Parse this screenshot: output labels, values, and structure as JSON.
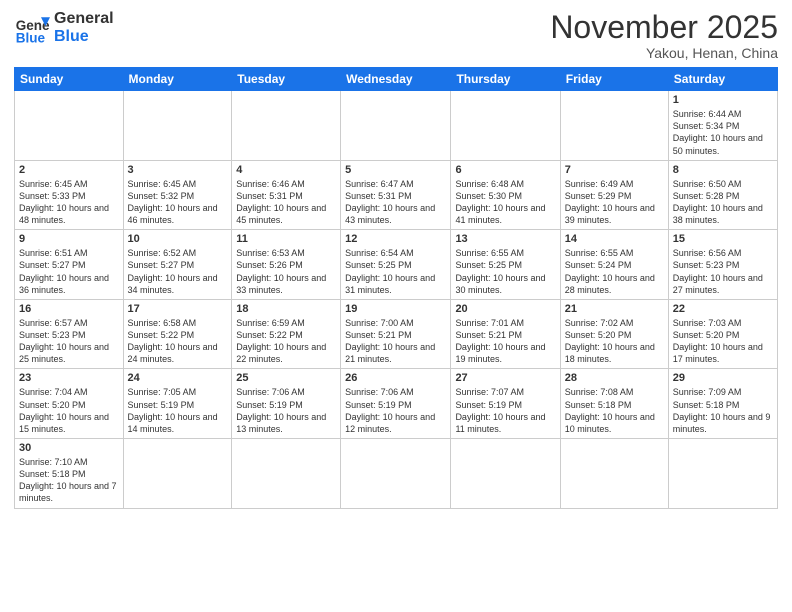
{
  "logo": {
    "text_general": "General",
    "text_blue": "Blue"
  },
  "header": {
    "month": "November 2025",
    "location": "Yakou, Henan, China"
  },
  "days_of_week": [
    "Sunday",
    "Monday",
    "Tuesday",
    "Wednesday",
    "Thursday",
    "Friday",
    "Saturday"
  ],
  "weeks": [
    [
      {
        "day": "",
        "info": ""
      },
      {
        "day": "",
        "info": ""
      },
      {
        "day": "",
        "info": ""
      },
      {
        "day": "",
        "info": ""
      },
      {
        "day": "",
        "info": ""
      },
      {
        "day": "",
        "info": ""
      },
      {
        "day": "1",
        "info": "Sunrise: 6:44 AM\nSunset: 5:34 PM\nDaylight: 10 hours and 50 minutes."
      }
    ],
    [
      {
        "day": "2",
        "info": "Sunrise: 6:45 AM\nSunset: 5:33 PM\nDaylight: 10 hours and 48 minutes."
      },
      {
        "day": "3",
        "info": "Sunrise: 6:45 AM\nSunset: 5:32 PM\nDaylight: 10 hours and 46 minutes."
      },
      {
        "day": "4",
        "info": "Sunrise: 6:46 AM\nSunset: 5:31 PM\nDaylight: 10 hours and 45 minutes."
      },
      {
        "day": "5",
        "info": "Sunrise: 6:47 AM\nSunset: 5:31 PM\nDaylight: 10 hours and 43 minutes."
      },
      {
        "day": "6",
        "info": "Sunrise: 6:48 AM\nSunset: 5:30 PM\nDaylight: 10 hours and 41 minutes."
      },
      {
        "day": "7",
        "info": "Sunrise: 6:49 AM\nSunset: 5:29 PM\nDaylight: 10 hours and 39 minutes."
      },
      {
        "day": "8",
        "info": "Sunrise: 6:50 AM\nSunset: 5:28 PM\nDaylight: 10 hours and 38 minutes."
      }
    ],
    [
      {
        "day": "9",
        "info": "Sunrise: 6:51 AM\nSunset: 5:27 PM\nDaylight: 10 hours and 36 minutes."
      },
      {
        "day": "10",
        "info": "Sunrise: 6:52 AM\nSunset: 5:27 PM\nDaylight: 10 hours and 34 minutes."
      },
      {
        "day": "11",
        "info": "Sunrise: 6:53 AM\nSunset: 5:26 PM\nDaylight: 10 hours and 33 minutes."
      },
      {
        "day": "12",
        "info": "Sunrise: 6:54 AM\nSunset: 5:25 PM\nDaylight: 10 hours and 31 minutes."
      },
      {
        "day": "13",
        "info": "Sunrise: 6:55 AM\nSunset: 5:25 PM\nDaylight: 10 hours and 30 minutes."
      },
      {
        "day": "14",
        "info": "Sunrise: 6:55 AM\nSunset: 5:24 PM\nDaylight: 10 hours and 28 minutes."
      },
      {
        "day": "15",
        "info": "Sunrise: 6:56 AM\nSunset: 5:23 PM\nDaylight: 10 hours and 27 minutes."
      }
    ],
    [
      {
        "day": "16",
        "info": "Sunrise: 6:57 AM\nSunset: 5:23 PM\nDaylight: 10 hours and 25 minutes."
      },
      {
        "day": "17",
        "info": "Sunrise: 6:58 AM\nSunset: 5:22 PM\nDaylight: 10 hours and 24 minutes."
      },
      {
        "day": "18",
        "info": "Sunrise: 6:59 AM\nSunset: 5:22 PM\nDaylight: 10 hours and 22 minutes."
      },
      {
        "day": "19",
        "info": "Sunrise: 7:00 AM\nSunset: 5:21 PM\nDaylight: 10 hours and 21 minutes."
      },
      {
        "day": "20",
        "info": "Sunrise: 7:01 AM\nSunset: 5:21 PM\nDaylight: 10 hours and 19 minutes."
      },
      {
        "day": "21",
        "info": "Sunrise: 7:02 AM\nSunset: 5:20 PM\nDaylight: 10 hours and 18 minutes."
      },
      {
        "day": "22",
        "info": "Sunrise: 7:03 AM\nSunset: 5:20 PM\nDaylight: 10 hours and 17 minutes."
      }
    ],
    [
      {
        "day": "23",
        "info": "Sunrise: 7:04 AM\nSunset: 5:20 PM\nDaylight: 10 hours and 15 minutes."
      },
      {
        "day": "24",
        "info": "Sunrise: 7:05 AM\nSunset: 5:19 PM\nDaylight: 10 hours and 14 minutes."
      },
      {
        "day": "25",
        "info": "Sunrise: 7:06 AM\nSunset: 5:19 PM\nDaylight: 10 hours and 13 minutes."
      },
      {
        "day": "26",
        "info": "Sunrise: 7:06 AM\nSunset: 5:19 PM\nDaylight: 10 hours and 12 minutes."
      },
      {
        "day": "27",
        "info": "Sunrise: 7:07 AM\nSunset: 5:19 PM\nDaylight: 10 hours and 11 minutes."
      },
      {
        "day": "28",
        "info": "Sunrise: 7:08 AM\nSunset: 5:18 PM\nDaylight: 10 hours and 10 minutes."
      },
      {
        "day": "29",
        "info": "Sunrise: 7:09 AM\nSunset: 5:18 PM\nDaylight: 10 hours and 9 minutes."
      }
    ],
    [
      {
        "day": "30",
        "info": "Sunrise: 7:10 AM\nSunset: 5:18 PM\nDaylight: 10 hours and 7 minutes."
      },
      {
        "day": "",
        "info": ""
      },
      {
        "day": "",
        "info": ""
      },
      {
        "day": "",
        "info": ""
      },
      {
        "day": "",
        "info": ""
      },
      {
        "day": "",
        "info": ""
      },
      {
        "day": "",
        "info": ""
      }
    ]
  ]
}
